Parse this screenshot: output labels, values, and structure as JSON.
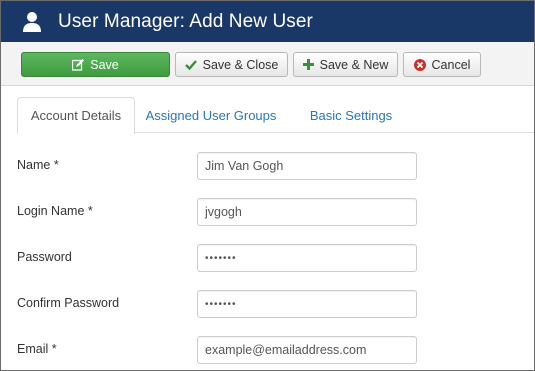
{
  "header": {
    "title": "User Manager: Add New User",
    "icon": "user-icon",
    "bg": "#1a3867"
  },
  "toolbar": {
    "save_label": "Save",
    "save_close_label": "Save & Close",
    "save_new_label": "Save & New",
    "cancel_label": "Cancel"
  },
  "tabs": [
    {
      "label": "Account Details",
      "active": true
    },
    {
      "label": "Assigned User Groups",
      "active": false
    },
    {
      "label": "Basic Settings",
      "active": false
    }
  ],
  "form": {
    "name": {
      "label": "Name *",
      "value": "Jim Van Gogh"
    },
    "login": {
      "label": "Login Name *",
      "value": "jvgogh"
    },
    "password": {
      "label": "Password",
      "value": "•••••••"
    },
    "confirm": {
      "label": "Confirm Password",
      "value": "•••••••"
    },
    "email": {
      "label": "Email *",
      "value": "example@emailaddress.com"
    }
  },
  "colors": {
    "accent_link": "#2a75b8",
    "save_green": "#4cae4c",
    "cancel_red": "#c9302c"
  }
}
